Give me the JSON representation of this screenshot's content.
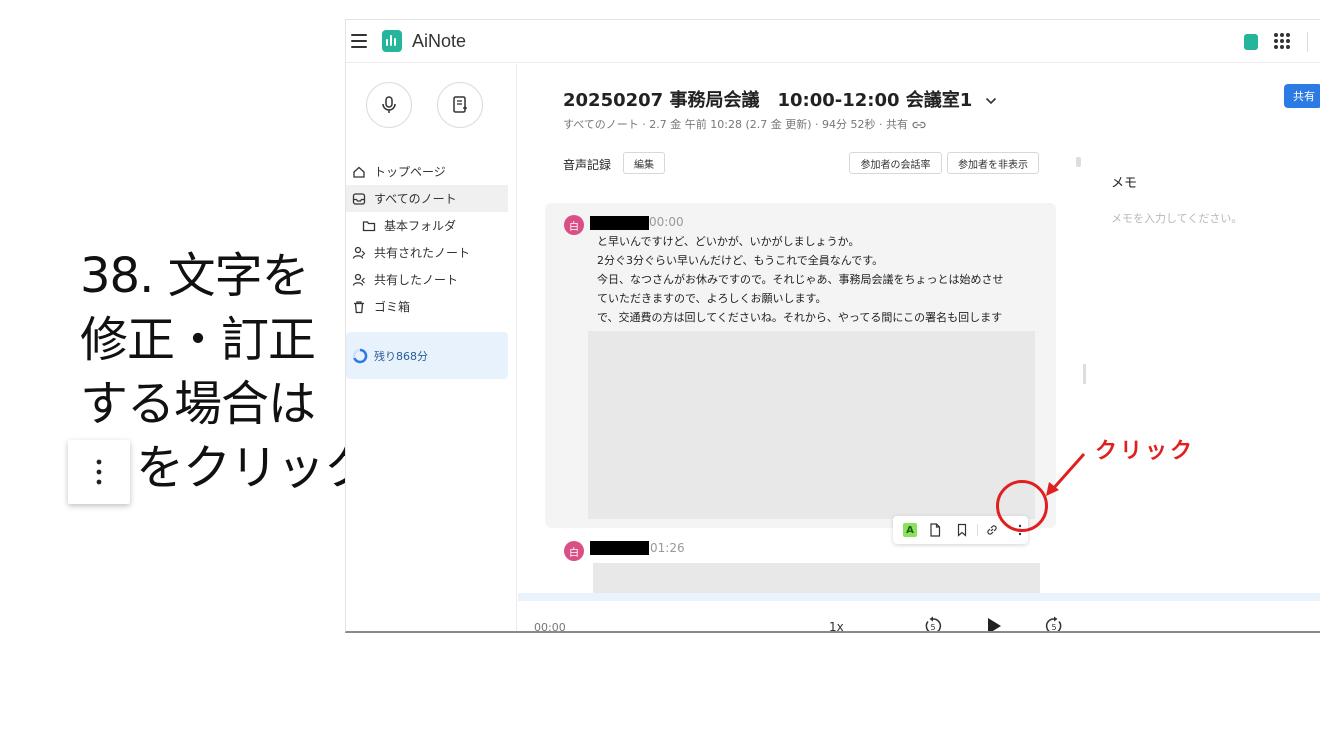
{
  "slide": {
    "instruction_lines": [
      "38. 文字を",
      "修正・訂正",
      "する場合は",
      "をクリック"
    ],
    "callout": "クリック"
  },
  "header": {
    "app_name": "AiNote"
  },
  "sidebar": {
    "items": [
      {
        "label": "トップページ",
        "icon": "home-icon"
      },
      {
        "label": "すべてのノート",
        "icon": "inbox-icon"
      },
      {
        "label": "基本フォルダ",
        "icon": "folder-icon"
      },
      {
        "label": "共有されたノート",
        "icon": "person-shared-icon"
      },
      {
        "label": "共有したノート",
        "icon": "person-share-icon"
      },
      {
        "label": "ゴミ箱",
        "icon": "trash-icon"
      }
    ],
    "remaining": "残り868分"
  },
  "note": {
    "title": "20250207 事務局会議　10:00-12:00 会議室1",
    "meta": "すべてのノート · 2.7 金 午前 10:28 (2.7 金 更新) · 94分 52秒 · 共有",
    "share_button": "共有",
    "section_label": "音声記録",
    "edit_button": "編集",
    "participants_rate_button": "参加者の会話率",
    "hide_participants_button": "参加者を非表示"
  },
  "transcript": [
    {
      "avatar": "白",
      "time": "00:00",
      "lines": [
        "と早いんですけど、どいかが、いかがしましょうか。",
        "2分ぐ3分ぐらい早いんだけど、もうこれで全員なんです。",
        "今日、なつさんがお休みですので。それじゃあ、事務局会議をちょっとは始めさせ",
        "ていただきますので、よろしくお願いします。",
        "で、交通費の方は回してくださいね。それから、やってる間にこの署名も回します"
      ]
    },
    {
      "avatar": "白",
      "time": "01:26",
      "lines": []
    }
  ],
  "toolbar": {
    "a_label": "A"
  },
  "memo": {
    "title": "メモ",
    "placeholder": "メモを入力してください。"
  },
  "player": {
    "time": "00:00",
    "speed": "1x"
  },
  "colors": {
    "accent": "#2c7be5",
    "brand": "#25b59b",
    "callout": "#e02020",
    "avatar": "#d94f86"
  }
}
